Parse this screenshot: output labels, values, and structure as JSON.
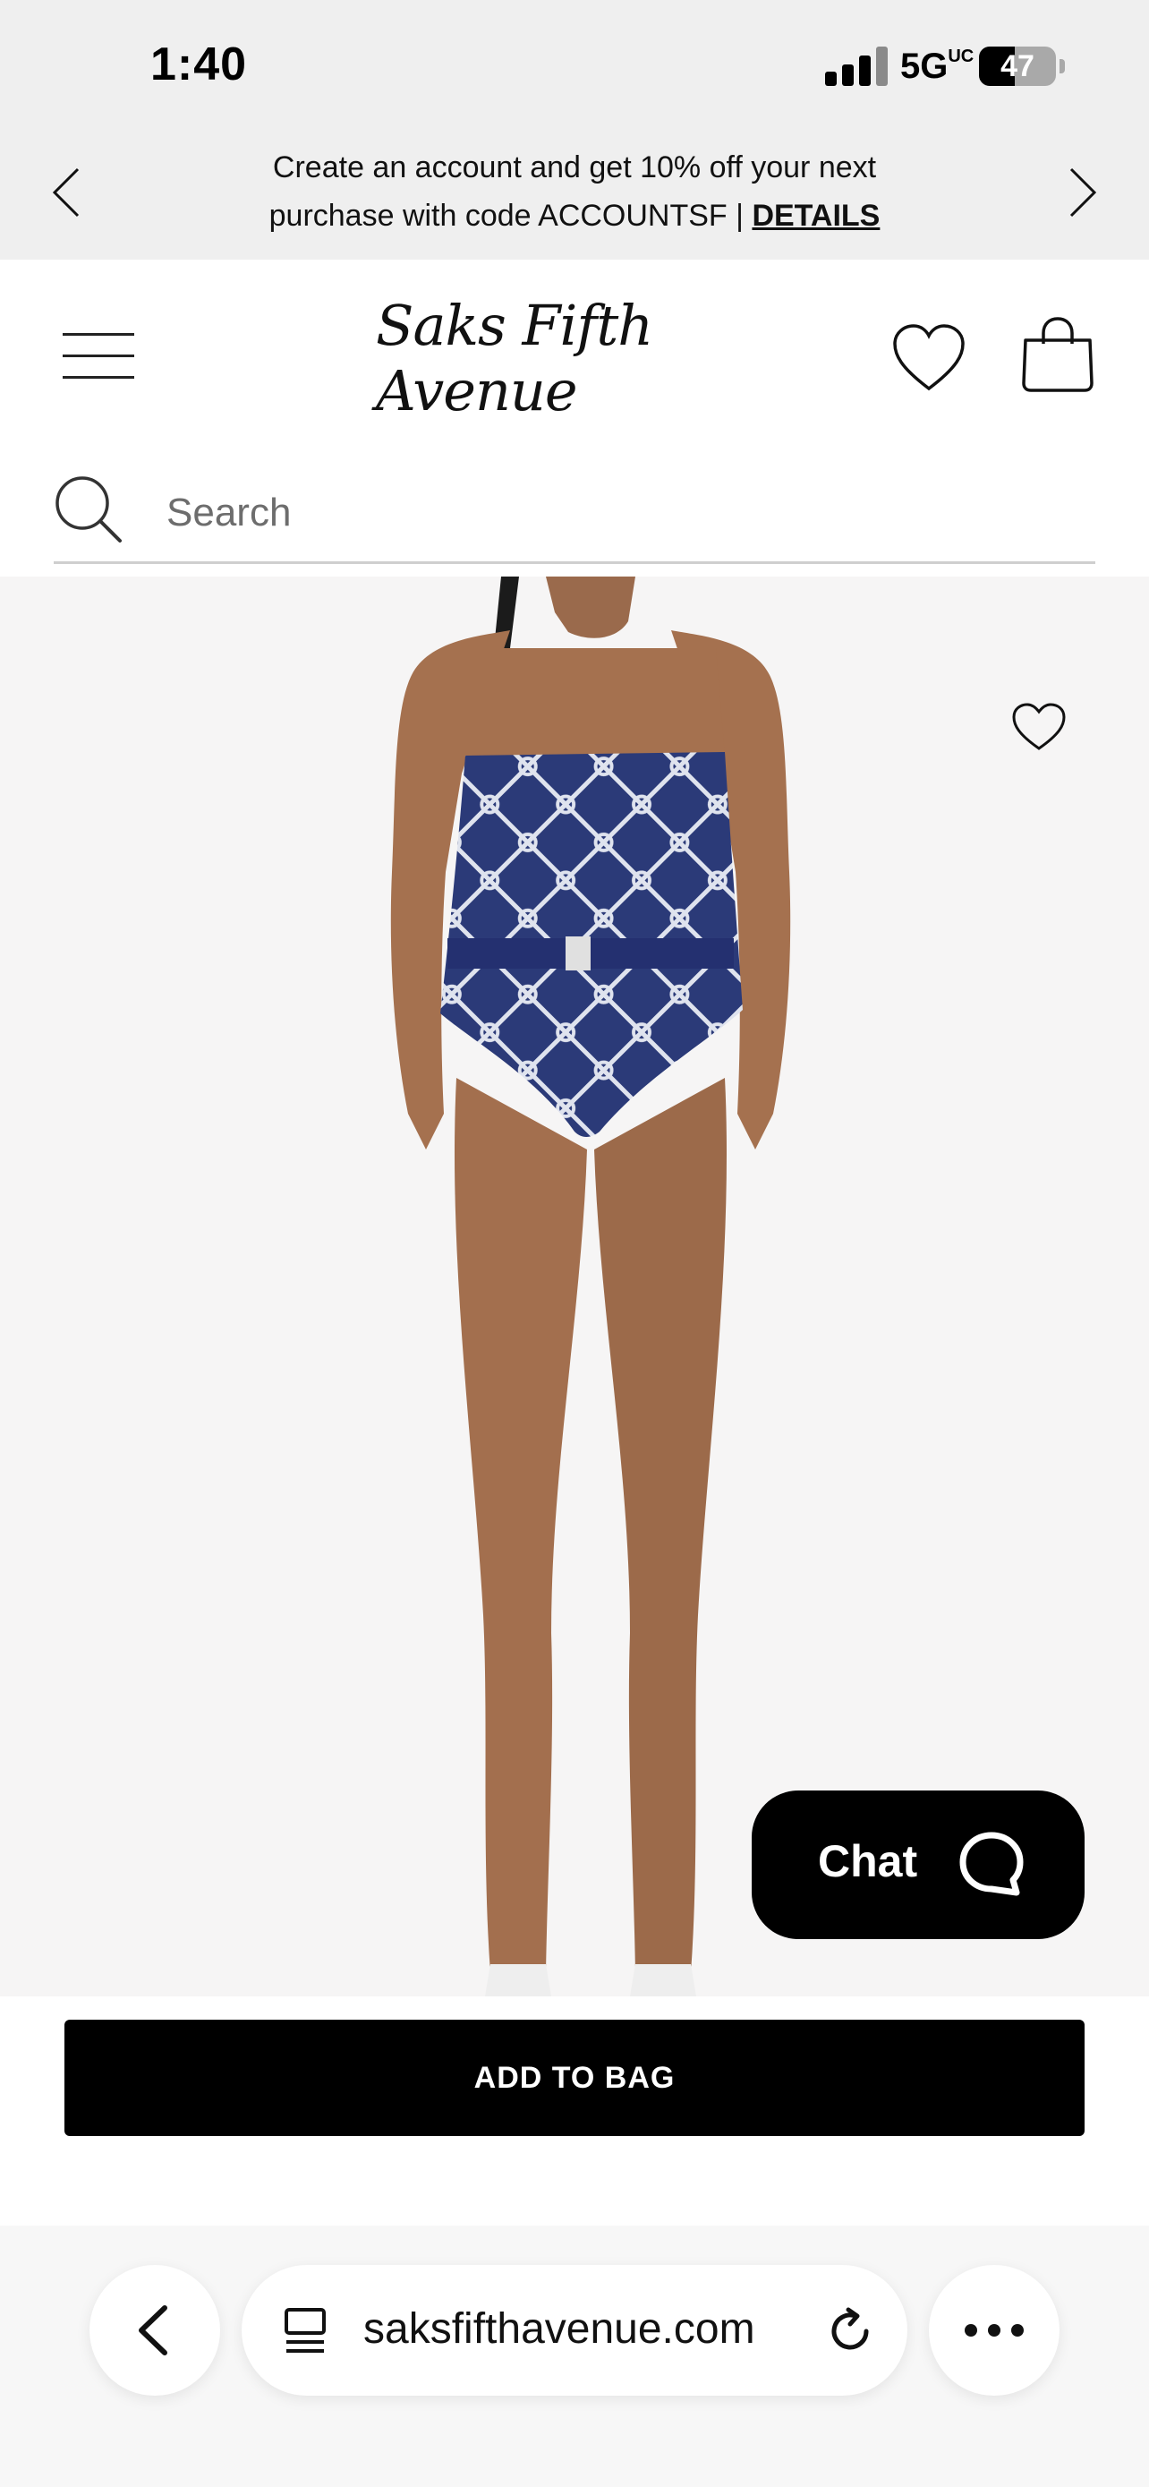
{
  "status_bar": {
    "time": "1:40",
    "network": "5G",
    "network_suffix": "UC",
    "battery": "47",
    "battery_level": 0.47
  },
  "promo": {
    "text_line1": "Create an account and get 10% off your next",
    "text_line2": "purchase with code ACCOUNTSF |",
    "link": "DETAILS"
  },
  "header": {
    "logo": "Saks Fifth Avenue"
  },
  "search": {
    "placeholder": "Search"
  },
  "product": {
    "image_alt": "Model wearing navy rope-print strapless belted one-piece swimsuit",
    "swimsuit_color": "#2b3a78"
  },
  "chat": {
    "label": "Chat"
  },
  "actions": {
    "add_to_bag": "ADD TO BAG"
  },
  "browser": {
    "url": "saksfifthavenue.com"
  },
  "icons": {
    "promo_prev": "chevron-left-icon",
    "promo_next": "chevron-right-icon",
    "menu": "hamburger-menu-icon",
    "wishlist": "heart-icon",
    "bag": "shopping-bag-icon",
    "search": "search-icon",
    "favorite": "heart-icon",
    "chat": "chat-bubble-icon",
    "back": "chevron-left-icon",
    "tabs": "tabs-icon",
    "reload": "reload-icon",
    "more": "ellipsis-icon"
  }
}
